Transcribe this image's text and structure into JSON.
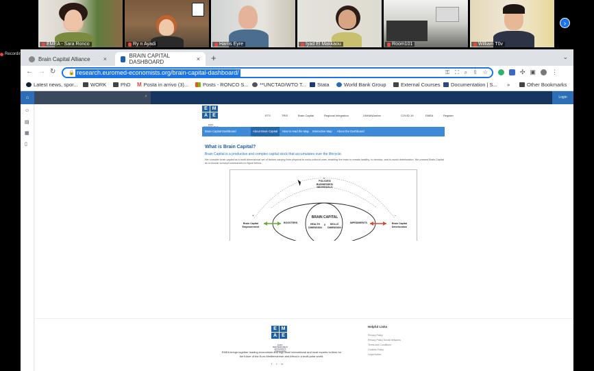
{
  "meeting": {
    "participants": [
      {
        "name": "EMEA - Sara Ronco"
      },
      {
        "name": "Ry n Ayadi"
      },
      {
        "name": "Harris Eyre"
      },
      {
        "name": "Iyad El Makkaou"
      },
      {
        "name": "Room101"
      },
      {
        "name": "William T0v"
      }
    ],
    "recording_label": "Recordin"
  },
  "browser": {
    "tabs": [
      {
        "label": "Brain Capital Alliance"
      },
      {
        "label": "BRAIN CAPITAL DASHBOARD"
      }
    ],
    "url": "research.euromed-economists.org/brain-capital-dashboard/",
    "bookmarks": [
      {
        "label": "Latest news, spor..."
      },
      {
        "label": "WORK"
      },
      {
        "label": "PhD"
      },
      {
        "label": "Posta in arrivo (3)..."
      },
      {
        "label": "Posts - RONCO S..."
      },
      {
        "label": "**UNCTAD/WTO T..."
      },
      {
        "label": "Stata"
      },
      {
        "label": "World Bank Group"
      },
      {
        "label": "External Courses"
      },
      {
        "label": "Documentation | S..."
      },
      {
        "label": "Other Bookmarks"
      }
    ],
    "overflow": "»"
  },
  "site": {
    "login": "Login",
    "logo_text": "EURO-MEDITERRANEAN ECONOMISTS ASSOCIATION",
    "nav": [
      "ETS",
      "TRIS",
      "Brain Capital",
      "Regional Integration",
      "UNHANAmber",
      "COVID-19",
      "EMEA",
      "Register"
    ],
    "subnav": [
      "Brain Capital Dashboard",
      "About Brain Capital",
      "How to read the Map",
      "Interactive Map",
      "About the Dashboard"
    ],
    "heading": "What is Brain Capital?",
    "subheading": "Brain Capital is a productive and complex capital stock that accumulates over the lifecycle.",
    "body": "We consider brain capital as a multi-dimensional set of factors varying from physical to socio-cultural ones, enabling the brain to remain healthy, to develop, and to avoid deterioration. We present Brain Capital as a circular concept summarized in figure below.",
    "figure": {
      "top": "POLICIES/ BUSINESSES/ INDIVIDUALS",
      "center": "BRAIN CAPITAL",
      "health": "HEALTH DIMENSION",
      "x": "X",
      "skills": "SKILLS DIMENSION",
      "boosters": "BOOSTERS",
      "impediments": "IMPEDIMENTS",
      "left": "Brain Capital Empowerment",
      "right": "Brain Capital Deterioration"
    },
    "footer": {
      "text": "EMEA brings together leading economists and high-level international and local experts to think for the future of the Euro-Mediterranean and Africa in a multi-polar world.",
      "links_heading": "Helpful Links",
      "links": [
        "Privacy Policy",
        "Privacy Policy Social Networks",
        "Terms and Conditions",
        "Cookies Policy",
        "Legal Notice"
      ]
    }
  }
}
